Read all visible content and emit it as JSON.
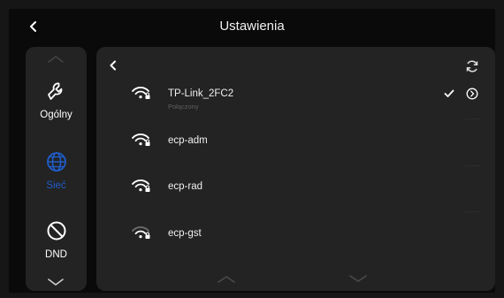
{
  "header": {
    "title": "Ustawienia"
  },
  "sidebar": {
    "items": [
      {
        "label": "Ogólny",
        "icon": "wrench-icon",
        "active": false
      },
      {
        "label": "Sieć",
        "icon": "globe-icon",
        "active": true
      },
      {
        "label": "DND",
        "icon": "do-not-disturb-icon",
        "active": false
      }
    ]
  },
  "networks": [
    {
      "ssid": "TP-Link_2FC2",
      "status": "Połączony",
      "connected": true
    },
    {
      "ssid": "ecp-adm",
      "status": "",
      "connected": false
    },
    {
      "ssid": "ecp-rad",
      "status": "",
      "connected": false
    },
    {
      "ssid": "ecp-gst",
      "status": "",
      "connected": false
    }
  ],
  "colors": {
    "accent": "#1f5cc8",
    "background": "#0a0a0a",
    "panel": "#232323"
  }
}
